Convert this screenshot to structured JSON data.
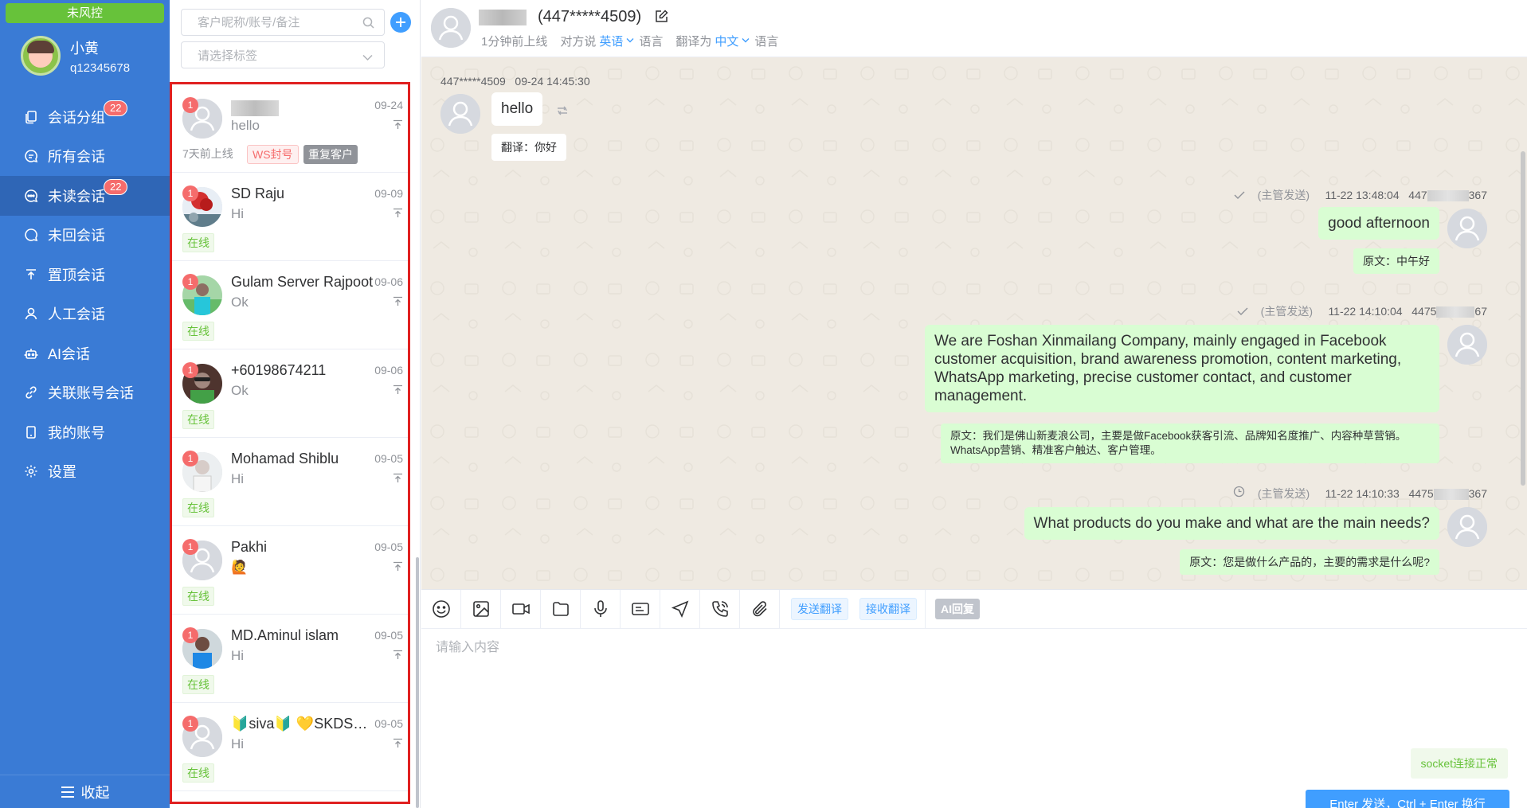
{
  "nav": {
    "risk_status": "未风控",
    "user": {
      "name": "小黄",
      "id": "q12345678"
    },
    "items": [
      {
        "label": "会话分组",
        "badge": "22",
        "icon": "copy-icon"
      },
      {
        "label": "所有会话",
        "badge": null,
        "icon": "chat-lines-icon"
      },
      {
        "label": "未读会话",
        "badge": "22",
        "icon": "chat-dots-icon",
        "active": true
      },
      {
        "label": "未回会话",
        "badge": null,
        "icon": "chat-bubble-icon"
      },
      {
        "label": "置顶会话",
        "badge": null,
        "icon": "upload-icon"
      },
      {
        "label": "人工会话",
        "badge": null,
        "icon": "user-icon"
      },
      {
        "label": "AI会话",
        "badge": null,
        "icon": "robot-icon"
      },
      {
        "label": "关联账号会话",
        "badge": null,
        "icon": "link-icon"
      },
      {
        "label": "我的账号",
        "badge": null,
        "icon": "phone-icon"
      },
      {
        "label": "设置",
        "badge": null,
        "icon": "gear-icon"
      }
    ],
    "collapse_label": "收起"
  },
  "list": {
    "search_placeholder": "客户昵称/账号/备注",
    "tag_placeholder": "请选择标签",
    "conversations": [
      {
        "name": "",
        "blurred": true,
        "date": "09-24",
        "message": "hello",
        "unread": "1",
        "status": "7天前上线",
        "tags": [
          "WS封号",
          "重复客户"
        ]
      },
      {
        "name": "SD Raju",
        "date": "09-09",
        "message": "Hi",
        "unread": "1",
        "status": "在线"
      },
      {
        "name": "Gulam Server Rajpoot",
        "date": "09-06",
        "message": "Ok",
        "unread": "1",
        "status": "在线"
      },
      {
        "name": "+60198674211",
        "date": "09-06",
        "message": "Ok",
        "unread": "1",
        "status": "在线"
      },
      {
        "name": "Mohamad Shiblu",
        "date": "09-05",
        "message": "Hi",
        "unread": "1",
        "status": "在线"
      },
      {
        "name": "Pakhi",
        "date": "09-05",
        "message": "🙋",
        "unread": "1",
        "status": "在线"
      },
      {
        "name": "MD.Aminul islam",
        "date": "09-05",
        "message": "Hi",
        "unread": "1",
        "status": "在线"
      },
      {
        "name": "🔰siva🔰 💛SKDS…",
        "date": "09-05",
        "message": "Hi",
        "unread": "1",
        "status": "在线"
      }
    ]
  },
  "chat": {
    "contact_phone": "(447*****4509)",
    "last_online": "1分钟前上线",
    "their_lang_prefix": "对方说",
    "their_lang": "英语",
    "lang_suffix": "语言",
    "translate_prefix": "翻译为",
    "translate_lang": "中文",
    "messages": [
      {
        "direction": "in",
        "sender": "447*****4509",
        "time": "09-24 14:45:30",
        "text": "hello",
        "translation": "翻译：你好"
      },
      {
        "direction": "out",
        "mode": "(主管发送)",
        "time": "11-22 13:48:04",
        "sender": "447",
        "sender_tail": "367",
        "text": "good afternoon",
        "translation": "原文：中午好",
        "status_icon": "check-icon"
      },
      {
        "direction": "out",
        "mode": "(主管发送)",
        "time": "11-22 14:10:04",
        "sender": "4475",
        "sender_tail": "67",
        "text": "We are Foshan Xinmailang Company, mainly engaged in Facebook customer acquisition, brand awareness promotion, content marketing, WhatsApp marketing, precise customer contact, and customer management.",
        "translation": "原文：我们是佛山新麦浪公司，主要是做Facebook获客引流、品牌知名度推广、内容种草营销。WhatsApp营销、精准客户触达、客户管理。",
        "status_icon": "check-icon"
      },
      {
        "direction": "out",
        "mode": "(主管发送)",
        "time": "11-22 14:10:33",
        "sender": "4475",
        "sender_tail": "367",
        "text": "What products do you make and what are the main needs?",
        "translation": "原文：您是做什么产品的，主要的需求是什么呢?",
        "status_icon": "clock-icon"
      }
    ]
  },
  "toolbar": {
    "tools": [
      "emoji-icon",
      "image-icon",
      "video-icon",
      "folder-icon",
      "microphone-icon",
      "card-icon",
      "location-icon",
      "call-icon",
      "attachment-icon"
    ],
    "send_translate": "发送翻译",
    "receive_translate": "接收翻译",
    "ai_reply": "AI回复"
  },
  "composer": {
    "placeholder": "请输入内容",
    "socket_status": "socket连接正常",
    "send_label": "Enter 发送，Ctrl + Enter 换行"
  },
  "colors": {
    "nav_bg": "#3a7bd5",
    "accent": "#409eff",
    "online": "#67c23a",
    "unread": "#f56c6c",
    "out_bubble": "#d9fdd3",
    "chat_bg": "#efeae2",
    "frame": "#e02020"
  }
}
